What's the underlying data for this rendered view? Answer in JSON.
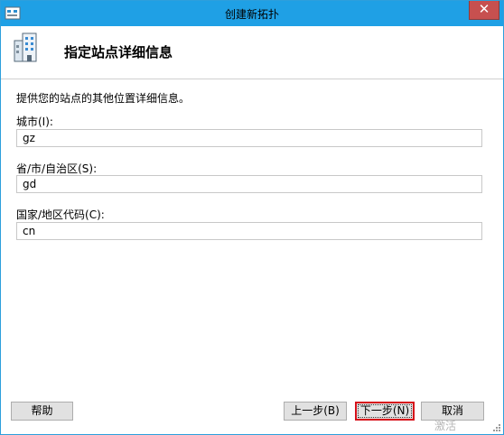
{
  "window": {
    "title": "创建新拓扑",
    "close_symbol": "✕"
  },
  "header": {
    "title": "指定站点详细信息",
    "icon": "building-icon"
  },
  "description": "提供您的站点的其他位置详细信息。",
  "fields": {
    "city": {
      "label": "城市(I):",
      "value": "gz"
    },
    "province": {
      "label": "省/市/自治区(S):",
      "value": "gd"
    },
    "country": {
      "label": "国家/地区代码(C):",
      "value": "cn"
    }
  },
  "buttons": {
    "help": "帮助",
    "back": "上一步(B)",
    "next": "下一步(N)",
    "cancel": "取消"
  },
  "watermark": "激活",
  "colors": {
    "titlebar": "#1fa0e5",
    "close_button": "#c7504f",
    "focus_outline": "#d6101a",
    "button_face": "#e1e1e1"
  }
}
